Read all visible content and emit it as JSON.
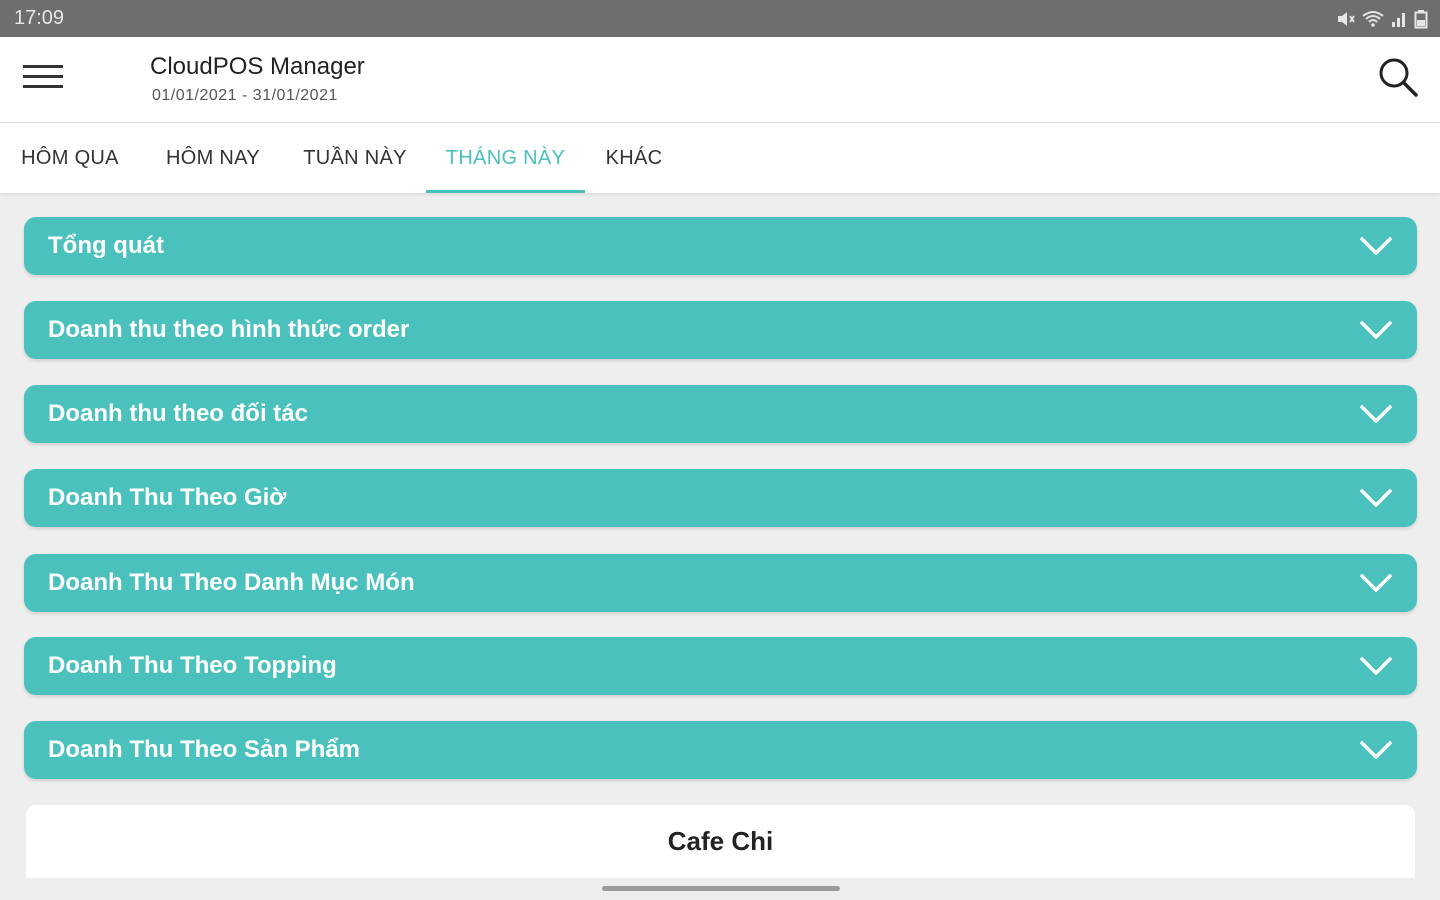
{
  "status_bar": {
    "time": "17:09",
    "icons": [
      "mute-icon",
      "wifi-icon",
      "signal-icon",
      "battery-icon"
    ]
  },
  "app_bar": {
    "title": "CloudPOS Manager",
    "subtitle": "01/01/2021 - 31/01/2021"
  },
  "tabs": [
    {
      "label": "HÔM QUA",
      "active": false
    },
    {
      "label": "HÔM NAY",
      "active": false
    },
    {
      "label": "TUẦN NÀY",
      "active": false
    },
    {
      "label": "THÁNG NÀY",
      "active": true
    },
    {
      "label": "KHÁC",
      "active": false
    }
  ],
  "sections": [
    {
      "label": "Tổng quát"
    },
    {
      "label": "Doanh thu theo hình thức order"
    },
    {
      "label": "Doanh thu theo đối tác"
    },
    {
      "label": "Doanh Thu Theo Giờ"
    },
    {
      "label": "Doanh Thu Theo Danh Mục Món"
    },
    {
      "label": "Doanh Thu Theo Topping"
    },
    {
      "label": "Doanh Thu Theo Sản Phẩm"
    }
  ],
  "store": {
    "name": "Cafe Chi"
  },
  "colors": {
    "accent": "#4ac1bd",
    "status_bar": "#6e6e6e",
    "background": "#eeeeee"
  }
}
